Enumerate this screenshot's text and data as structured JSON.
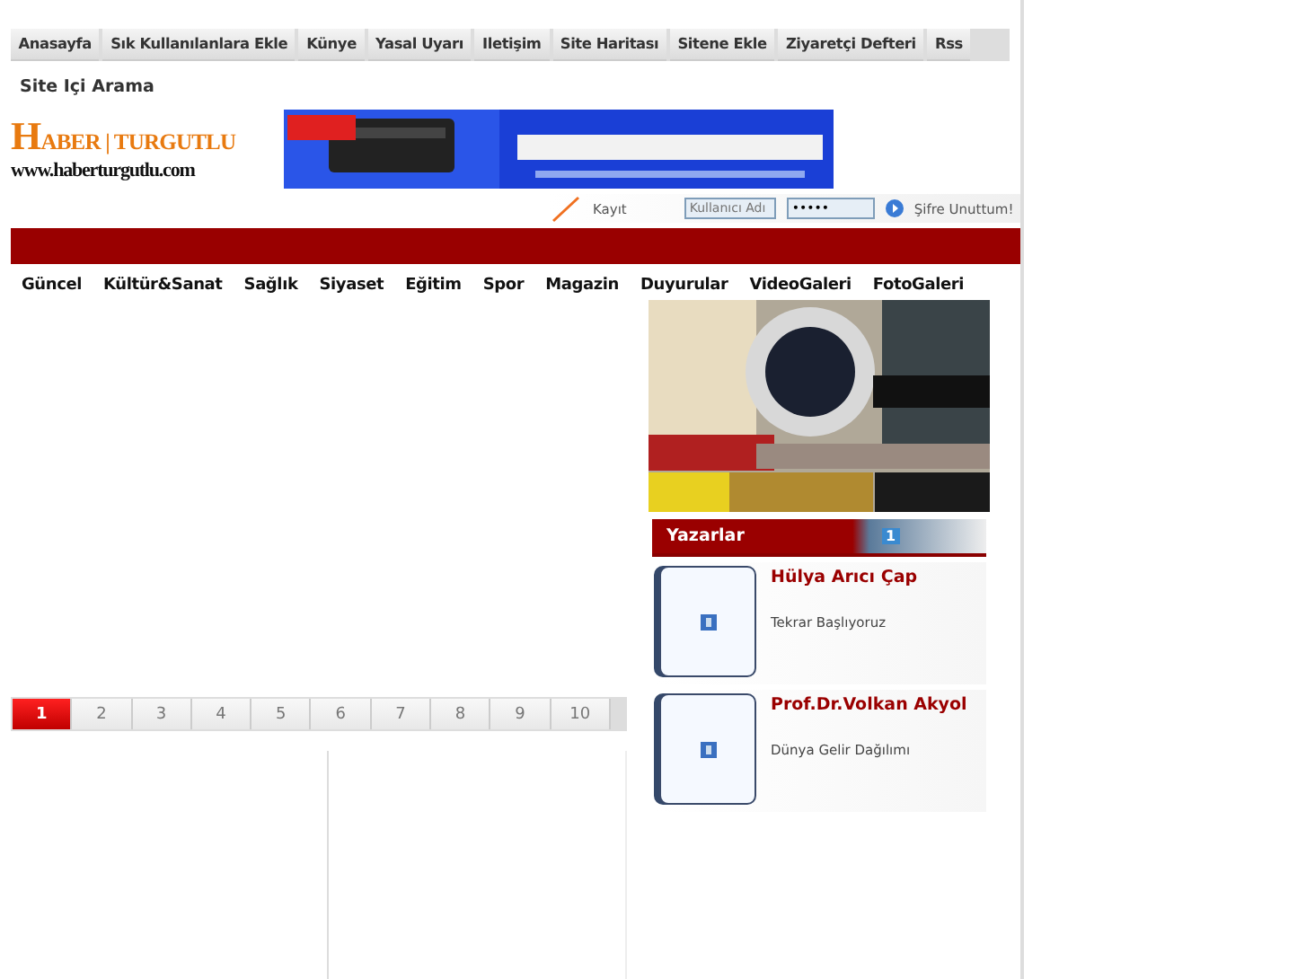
{
  "top_nav": [
    {
      "label": "Anasayfa"
    },
    {
      "label": "Sık Kullanılanlara Ekle"
    },
    {
      "label": "Künye"
    },
    {
      "label": "Yasal Uyarı"
    },
    {
      "label": "Iletişim"
    },
    {
      "label": "Site Haritası"
    },
    {
      "label": "Sitene Ekle"
    },
    {
      "label": "Ziyaretçi Defteri"
    },
    {
      "label": "Rss"
    }
  ],
  "search_link": "Site Içi Arama",
  "logo": {
    "title": "HABER | TURGUTLU",
    "url": "www.haberturgutlu.com"
  },
  "login": {
    "register": "Kayıt",
    "username_placeholder": "Kullanıcı Adı",
    "password_value": "•••••",
    "forgot": "Şifre Unuttum!"
  },
  "menu": [
    "Güncel",
    "Kültür&Sanat",
    "Sağlık",
    "Siyaset",
    "Eğitim",
    "Spor",
    "Magazin",
    "Duyurular",
    "VideoGaleri",
    "FotoGaleri"
  ],
  "pager": [
    {
      "label": "1",
      "selected": true
    },
    {
      "label": "2",
      "selected": false
    },
    {
      "label": "3",
      "selected": false
    },
    {
      "label": "4",
      "selected": false
    },
    {
      "label": "5",
      "selected": false
    },
    {
      "label": "6",
      "selected": false
    },
    {
      "label": "7",
      "selected": false
    },
    {
      "label": "8",
      "selected": false
    },
    {
      "label": "9",
      "selected": false
    },
    {
      "label": "10",
      "selected": false
    }
  ],
  "writers": {
    "title": "Yazarlar",
    "page": "1",
    "items": [
      {
        "name": "Hülya Arıcı Çap",
        "article": "Tekrar Başlıyoruz"
      },
      {
        "name": "Prof.Dr.Volkan Akyol",
        "article": "Dünya Gelir Dağılımı"
      }
    ]
  }
}
